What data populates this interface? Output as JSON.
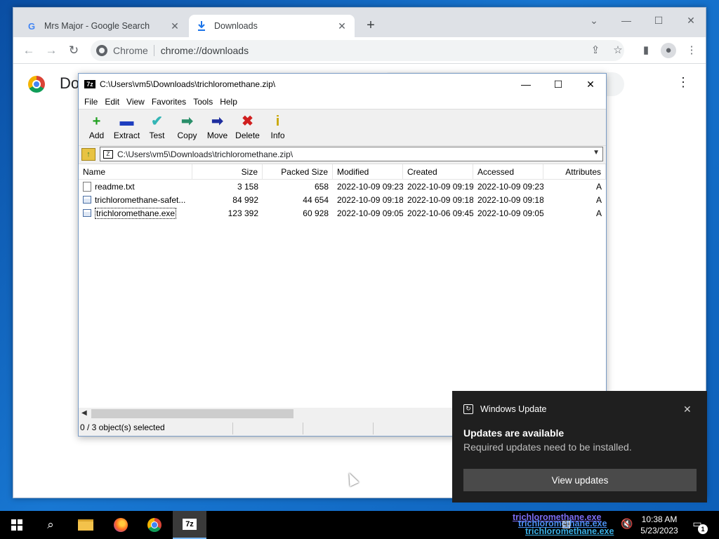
{
  "browser": {
    "tabs": [
      {
        "title": "Mrs Major - Google Search",
        "favicon": "G",
        "close": "✕"
      },
      {
        "title": "Downloads",
        "favicon": "download-icon",
        "close": "✕"
      }
    ],
    "new_tab": "+",
    "omnibox_scheme": "Chrome",
    "omnibox_url": "chrome://downloads",
    "page_heading": "Do"
  },
  "sevenzip": {
    "title": "C:\\Users\\vm5\\Downloads\\trichloromethane.zip\\",
    "menu": [
      "File",
      "Edit",
      "View",
      "Favorites",
      "Tools",
      "Help"
    ],
    "tools": [
      {
        "label": "Add",
        "glyph": "+",
        "color": "#1fa01f"
      },
      {
        "label": "Extract",
        "glyph": "▬",
        "color": "#1f3fbf"
      },
      {
        "label": "Test",
        "glyph": "✔",
        "color": "#33b5b5"
      },
      {
        "label": "Copy",
        "glyph": "➡",
        "color": "#2a8f6a"
      },
      {
        "label": "Move",
        "glyph": "➡",
        "color": "#1f2f9f"
      },
      {
        "label": "Delete",
        "glyph": "✖",
        "color": "#d01f1f"
      },
      {
        "label": "Info",
        "glyph": "i",
        "color": "#c8a600"
      }
    ],
    "address": "C:\\Users\\vm5\\Downloads\\trichloromethane.zip\\",
    "columns": [
      "Name",
      "Size",
      "Packed Size",
      "Modified",
      "Created",
      "Accessed",
      "Attributes"
    ],
    "rows": [
      {
        "name": "readme.txt",
        "size": "3 158",
        "packed": "658",
        "modified": "2022-10-09 09:23",
        "created": "2022-10-09 09:19",
        "accessed": "2022-10-09 09:23",
        "attr": "A",
        "icon": "text-file"
      },
      {
        "name": "trichloromethane-safet...",
        "size": "84 992",
        "packed": "44 654",
        "modified": "2022-10-09 09:18",
        "created": "2022-10-09 09:18",
        "accessed": "2022-10-09 09:18",
        "attr": "A",
        "icon": "exe-file"
      },
      {
        "name": "trichloromethane.exe",
        "size": "123 392",
        "packed": "60 928",
        "modified": "2022-10-09 09:05",
        "created": "2022-10-06 09:45",
        "accessed": "2022-10-09 09:05",
        "attr": "A",
        "icon": "exe-file"
      }
    ],
    "status": "0 / 3 object(s) selected"
  },
  "toast": {
    "app": "Windows Update",
    "title": "Updates are available",
    "message": "Required updates need to be installed.",
    "button": "View updates"
  },
  "taskbar": {
    "time": "10:38 AM",
    "date": "5/23/2023",
    "notification_count": "1",
    "tray_artifact_text": "trichloromethane.exe"
  }
}
